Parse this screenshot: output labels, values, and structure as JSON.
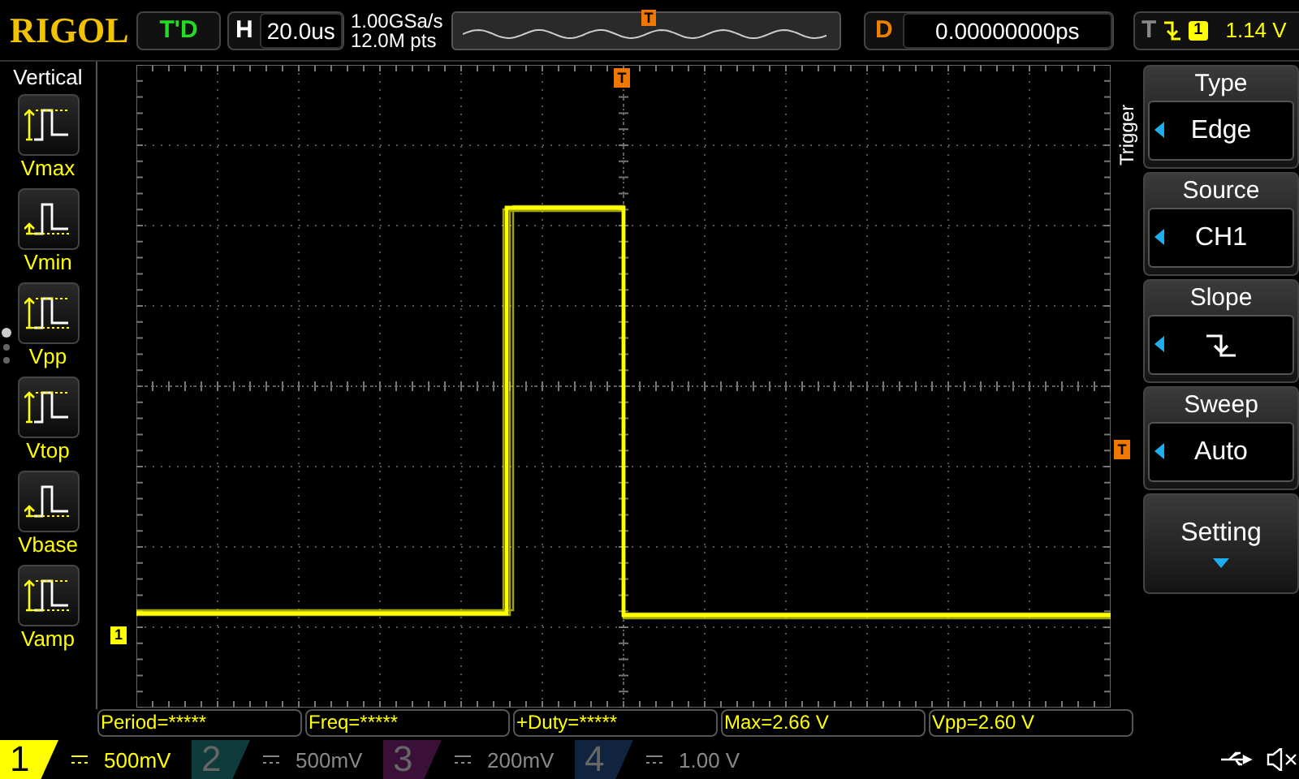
{
  "logo": "RIGOL",
  "run_status": "T'D",
  "horizontal": {
    "label": "H",
    "scale": "20.0us"
  },
  "acquisition": {
    "sample_rate": "1.00GSa/s",
    "memory_depth": "12.0M pts"
  },
  "overview": {
    "trigger_marker": "T"
  },
  "delay": {
    "label": "D",
    "value": "0.00000000ps"
  },
  "trigger_status": {
    "label": "T",
    "source": "1",
    "level": "1.14 V"
  },
  "sidebar": {
    "title": "Vertical",
    "pages": [
      {
        "selected": true
      },
      {
        "selected": false
      },
      {
        "selected": false
      }
    ],
    "items": [
      {
        "label": "Vmax"
      },
      {
        "label": "Vmin"
      },
      {
        "label": "Vpp"
      },
      {
        "label": "Vtop"
      },
      {
        "label": "Vbase"
      },
      {
        "label": "Vamp"
      }
    ]
  },
  "screen": {
    "trigger_position_marker": "T",
    "trigger_level_marker": "T",
    "channel_marker": "1"
  },
  "trigger_menu": {
    "title": "Trigger",
    "items": [
      {
        "kind": "value",
        "title": "Type",
        "value": "Edge"
      },
      {
        "kind": "value",
        "title": "Source",
        "value": "CH1"
      },
      {
        "kind": "slope",
        "title": "Slope"
      },
      {
        "kind": "value",
        "title": "Sweep",
        "value": "Auto"
      },
      {
        "kind": "submenu",
        "title": "Setting"
      }
    ]
  },
  "measurements": [
    "Period=*****",
    "Freq=*****",
    "+Duty=*****",
    "Max=2.66 V",
    "Vpp=2.60 V"
  ],
  "channels": [
    {
      "number": "1",
      "scale": "500mV",
      "on": true,
      "color": "#ffff00"
    },
    {
      "number": "2",
      "scale": "500mV",
      "on": false,
      "color": "#0f3b3b"
    },
    {
      "number": "3",
      "scale": "200mV",
      "on": false,
      "color": "#3a1038"
    },
    {
      "number": "4",
      "scale": "1.00 V",
      "on": false,
      "color": "#10233f"
    }
  ]
}
